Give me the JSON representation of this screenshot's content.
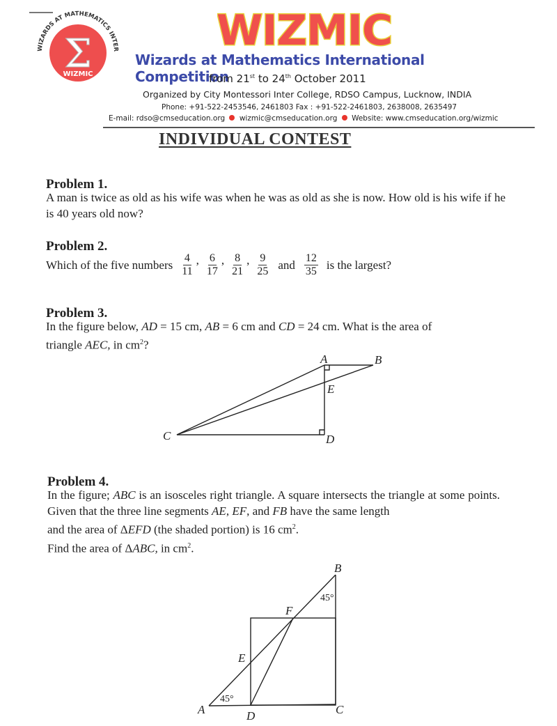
{
  "header": {
    "logo": {
      "ring_text": "WIZARDS AT MATHEMATICS INTERNATIONAL COMPETITION",
      "symbol": "Σ",
      "badge": "WIZMIC",
      "color": "#e84a4a"
    },
    "title": "WIZMIC",
    "title_color": "#f0504c",
    "title_outline": "#e8d23a",
    "subtitle": "Wizards at Mathematics International Competition",
    "subtitle_color": "#3c4aa8",
    "dates": {
      "prefix": "from 21",
      "start_sup": "st",
      "middle": " to 24",
      "end_sup": "th",
      "suffix": " October 2011"
    },
    "organized_by": "Organized by City Montessori Inter College, RDSO Campus, Lucknow, INDIA",
    "phone": "Phone: +91-522-2453546, 2461803 Fax : +91-522-2461803, 2638008, 2635497",
    "email1": "E-mail: rdso@cmseducation.org",
    "email2": "wizmic@cmseducation.org",
    "website": "Website: www.cmseducation.org/wizmic",
    "contest_title": "INDIVIDUAL CONTEST"
  },
  "problems": [
    {
      "heading": "Problem 1.",
      "text": "A man is twice as old as his wife was when he was as old as she is now. How old is his wife if he is 40 years old now?"
    },
    {
      "heading": "Problem 2.",
      "prefix": "Which of the five numbers",
      "fractions": [
        {
          "num": "4",
          "den": "11"
        },
        {
          "num": "6",
          "den": "17"
        },
        {
          "num": "8",
          "den": "21"
        },
        {
          "num": "9",
          "den": "25"
        },
        {
          "num": "12",
          "den": "35"
        }
      ],
      "and": "and",
      "suffix": "is the largest?"
    },
    {
      "heading": "Problem 3.",
      "text_a": "In the figure below, ",
      "AD": "AD",
      "eq1": " = 15 cm, ",
      "AB": "AB",
      "eq2": " = 6 cm and ",
      "CD": "CD",
      "eq3": " = 24 cm. What is the area of",
      "text_b": "triangle ",
      "AEC": "AEC,",
      "text_c": " in cm",
      "sup": "2",
      "text_d": "?",
      "figure_labels": {
        "A": "A",
        "B": "B",
        "C": "C",
        "D": "D",
        "E": "E"
      }
    },
    {
      "heading": "Problem 4.",
      "line1_a": "In the figure; ",
      "ABC": "ABC",
      "line1_b": " is an isosceles right triangle. A square intersects the triangle at",
      "line2_a": "some points. Given that the three line segments ",
      "AE": "AE",
      "comma1": ", ",
      "EF": "EF",
      "comma2": ", and ",
      "FB": "FB",
      "line2_b": " have the same length",
      "line3_a": "and the area of  Δ",
      "EFD": "EFD",
      "line3_b": " (the shaded portion) is 16 cm",
      "line3_sup": "2",
      "line3_c": ".",
      "line4_a": "Find the area of  Δ",
      "ABC2": "ABC,",
      "line4_b": " in cm",
      "line4_sup": "2",
      "line4_c": ".",
      "figure_labels": {
        "A": "A",
        "B": "B",
        "C": "C",
        "D": "D",
        "E": "E",
        "F": "F",
        "angle_A": "45°",
        "angle_B": "45°"
      }
    }
  ]
}
